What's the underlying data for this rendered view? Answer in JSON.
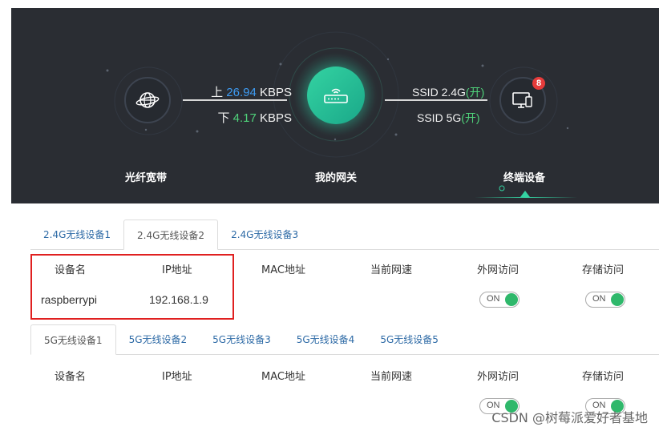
{
  "hero": {
    "upload_prefix": "上 ",
    "upload_value": "26.94",
    "upload_unit": " KBPS",
    "download_prefix": "下 ",
    "download_value": "4.17",
    "download_unit": " KBPS",
    "ssid_24_label": "SSID 2.4G",
    "ssid_24_state": "(开)",
    "ssid_5_label": "SSID 5G",
    "ssid_5_state": "(开)",
    "device_count": "8",
    "label_broadband": "光纤宽带",
    "label_gateway": "我的网关",
    "label_terminal": "终端设备",
    "icons": {
      "broadband": "globe-icon",
      "gateway": "router-icon",
      "terminal": "devices-icon"
    },
    "colors": {
      "background": "#2a2d33",
      "accent": "#34d3a2",
      "upload": "#3e9bf2",
      "download": "#4fd27a",
      "badge": "#e63b3b"
    }
  },
  "tabs_24": {
    "items": [
      "2.4G无线设备1",
      "2.4G无线设备2",
      "2.4G无线设备3"
    ],
    "active_index": 1
  },
  "table_24": {
    "headers": [
      "设备名",
      "IP地址",
      "MAC地址",
      "当前网速",
      "外网访问",
      "存储访问"
    ],
    "rows": [
      {
        "name": "raspberrypi",
        "ip": "192.168.1.9",
        "mac": "",
        "speed": "",
        "internet": "ON",
        "storage": "ON"
      }
    ]
  },
  "tabs_5": {
    "items": [
      "5G无线设备1",
      "5G无线设备2",
      "5G无线设备3",
      "5G无线设备4",
      "5G无线设备5"
    ],
    "active_index": 0
  },
  "table_5": {
    "headers": [
      "设备名",
      "IP地址",
      "MAC地址",
      "当前网速",
      "外网访问",
      "存储访问"
    ],
    "rows": [
      {
        "internet": "ON",
        "storage": "ON"
      }
    ]
  },
  "watermark": "CSDN @树莓派爱好者基地"
}
